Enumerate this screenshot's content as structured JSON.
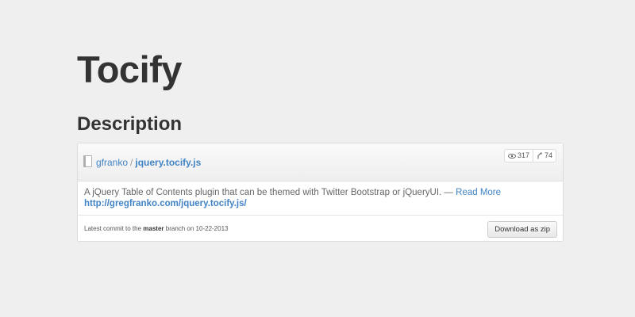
{
  "page": {
    "title": "Tocify",
    "section_heading": "Description"
  },
  "repo": {
    "owner": "gfranko",
    "separator": "/",
    "name": "jquery.tocify.js",
    "watchers": "317",
    "forks": "74",
    "description": "A jQuery Table of Contents plugin that can be themed with Twitter Bootstrap or jQueryUI. —",
    "read_more": "Read More",
    "homepage": "http://gregfranko.com/jquery.tocify.js/"
  },
  "footer": {
    "commit_prefix": "Latest commit to the",
    "branch": "master",
    "commit_suffix": "branch on 10-22-2013",
    "download_label": "Download as zip"
  },
  "colors": {
    "background": "#efefef",
    "link": "#4183c4",
    "heading": "#333333"
  },
  "icons": [
    "repo-icon",
    "eye-icon",
    "fork-icon"
  ]
}
